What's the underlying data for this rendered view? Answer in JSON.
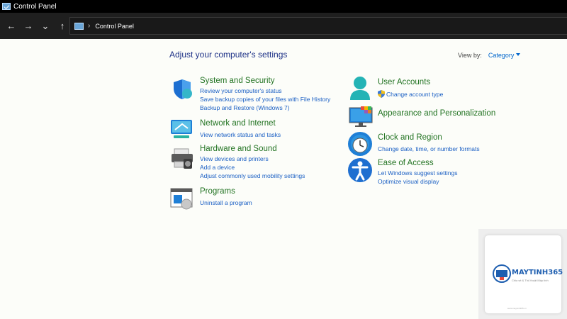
{
  "window": {
    "title": "Control Panel"
  },
  "nav": {
    "back": "←",
    "forward": "→",
    "recent": "⌄",
    "up": "↑"
  },
  "address": {
    "separator": "›",
    "crumb": "Control Panel"
  },
  "main": {
    "heading": "Adjust your computer's settings",
    "view_by_label": "View by:",
    "view_by_value": "Category"
  },
  "categories": [
    {
      "icon": "shield-icon",
      "title": "System and Security",
      "links": [
        "Review your computer's status",
        "Save backup copies of your files with File History",
        "Backup and Restore (Windows 7)"
      ]
    },
    {
      "icon": "network-icon",
      "title": "Network and Internet",
      "links": [
        "View network status and tasks"
      ]
    },
    {
      "icon": "printer-icon",
      "title": "Hardware and Sound",
      "links": [
        "View devices and printers",
        "Add a device",
        "Adjust commonly used mobility settings"
      ]
    },
    {
      "icon": "programs-icon",
      "title": "Programs",
      "links": [
        "Uninstall a program"
      ]
    },
    {
      "icon": "user-icon",
      "title": "User Accounts",
      "links": [
        "Change account type"
      ]
    },
    {
      "icon": "display-icon",
      "title": "Appearance and Personalization",
      "links": []
    },
    {
      "icon": "clock-icon",
      "title": "Clock and Region",
      "links": [
        "Change date, time, or number formats"
      ]
    },
    {
      "icon": "accessibility-icon",
      "title": "Ease of Access",
      "links": [
        "Let Windows suggest settings",
        "Optimize visual display"
      ]
    }
  ],
  "watermark": {
    "brand": "MAYTINH365",
    "tagline": "Chia sẻ & Thủ thuật Máy tính",
    "footer": "www.maytinh365.vn"
  },
  "colors": {
    "title_green": "#227322",
    "link_blue": "#1a5fc4",
    "heading_blue": "#1e3287"
  }
}
